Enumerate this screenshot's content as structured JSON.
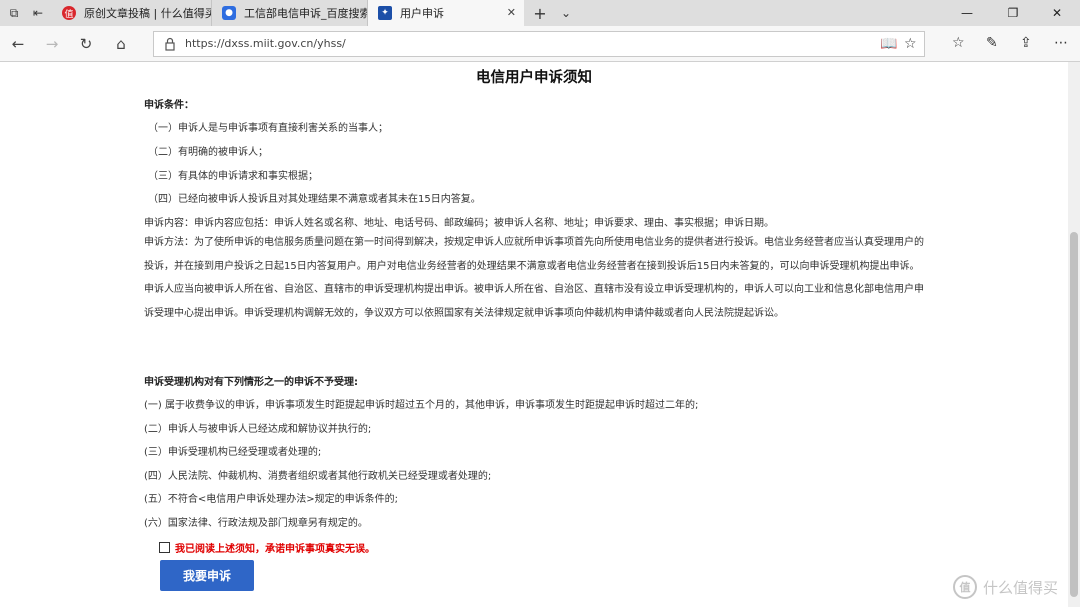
{
  "browser": {
    "tabs": [
      {
        "title": "原创文章投稿 | 什么值得买",
        "favicon": "red-circle-icon",
        "active": false
      },
      {
        "title": "工信部电信申诉_百度搜索",
        "favicon": "baidu-paw-icon",
        "active": false
      },
      {
        "title": "用户申诉",
        "favicon": "miit-emblem-icon",
        "active": true
      }
    ],
    "new_tab": "+",
    "address_url": "https://dxss.miit.gov.cn/yhss/"
  },
  "page": {
    "heading": "电信用户申诉须知",
    "conditions_title": "申诉条件：",
    "conditions": [
      "（一）申诉人是与申诉事项有直接利害关系的当事人；",
      "（二）有明确的被申诉人；",
      "（三）有具体的申诉请求和事实根据；",
      "（四）已经向被申诉人投诉且对其处理结果不满意或者其未在15日内答复。"
    ],
    "content_line": "申诉内容：申诉内容应包括：申诉人姓名或名称、地址、电话号码、邮政编码；被申诉人名称、地址；申诉要求、理由、事实根据；申诉日期。",
    "method_text": "申诉方法：为了使所申诉的电信服务质量问题在第一时间得到解决，按规定申诉人应就所申诉事项首先向所使用电信业务的提供者进行投诉。电信业务经营者应当认真受理用户的投诉，并在接到用户投诉之日起15日内答复用户。用户对电信业务经营者的处理结果不满意或者电信业务经营者在接到投诉后15日内未答复的，可以向申诉受理机构提出申诉。申诉人应当向被申诉人所在省、自治区、直辖市的申诉受理机构提出申诉。被申诉人所在省、自治区、直辖市没有设立申诉受理机构的，申诉人可以向工业和信息化部电信用户申诉受理中心提出申诉。申诉受理机构调解无效的，争议双方可以依照国家有关法律规定就申诉事项向仲裁机构申请仲裁或者向人民法院提起诉讼。",
    "rejection_title": "申诉受理机构对有下列情形之一的申诉不予受理:",
    "rejections": [
      "(一) 属于收费争议的申诉，申诉事项发生时距提起申诉时超过五个月的，其他申诉，申诉事项发生时距提起申诉时超过二年的;",
      "(二）申诉人与被申诉人已经达成和解协议并执行的;",
      "(三）申诉受理机构已经受理或者处理的;",
      "(四）人民法院、仲裁机构、消费者组织或者其他行政机关已经受理或者处理的;",
      "(五）不符合<电信用户申诉处理办法>规定的申诉条件的;",
      "(六）国家法律、行政法规及部门规章另有规定的。"
    ],
    "agree_text": "我已阅读上述须知，承诺申诉事项真实无误。",
    "submit_label": "我要申诉"
  },
  "watermark": {
    "logo": "值",
    "text": "什么值得买"
  },
  "colors": {
    "accent_button": "#2f66c7",
    "agree_text": "#e00000"
  }
}
